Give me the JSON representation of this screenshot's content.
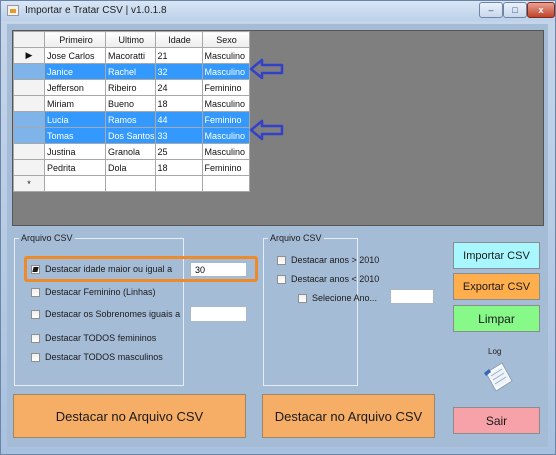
{
  "window": {
    "title": "Importar e Tratar CSV  | v1.0.1.8",
    "min_glyph": "–",
    "max_glyph": "□",
    "close_glyph": "x"
  },
  "grid": {
    "columns": [
      "Primeiro",
      "Ultimo",
      "Idade",
      "Sexo"
    ],
    "rows": [
      {
        "indicator": "▶",
        "primeiro": "Jose Carlos",
        "ultimo": "Macoratti",
        "idade": "21",
        "sexo": "Masculino",
        "selected": false
      },
      {
        "indicator": "",
        "primeiro": "Janice",
        "ultimo": "Rachel",
        "idade": "32",
        "sexo": "Masculino",
        "selected": true
      },
      {
        "indicator": "",
        "primeiro": "Jefferson",
        "ultimo": "Ribeiro",
        "idade": "24",
        "sexo": "Feminino",
        "selected": false
      },
      {
        "indicator": "",
        "primeiro": "Miriam",
        "ultimo": "Bueno",
        "idade": "18",
        "sexo": "Masculino",
        "selected": false
      },
      {
        "indicator": "",
        "primeiro": "Lucia",
        "ultimo": "Ramos",
        "idade": "44",
        "sexo": "Feminino",
        "selected": true
      },
      {
        "indicator": "",
        "primeiro": "Tomas",
        "ultimo": "Dos Santos",
        "idade": "33",
        "sexo": "Masculino",
        "selected": true
      },
      {
        "indicator": "",
        "primeiro": "Justina",
        "ultimo": "Granola",
        "idade": "25",
        "sexo": "Masculino",
        "selected": false
      },
      {
        "indicator": "",
        "primeiro": "Pedrita",
        "ultimo": "Dola",
        "idade": "18",
        "sexo": "Feminino",
        "selected": false
      }
    ],
    "new_row_indicator": "*"
  },
  "group_left": {
    "legend": "Arquivo  CSV",
    "options": [
      {
        "label": "Destacar idade maior ou igual a",
        "checked": true
      },
      {
        "label": "Destacar Feminino (Linhas)",
        "checked": false
      },
      {
        "label": "Destacar os Sobrenomes iguais a",
        "checked": false
      },
      {
        "label": "Destacar TODOS femininos",
        "checked": false
      },
      {
        "label": "Destacar TODOS masculinos",
        "checked": false
      }
    ],
    "idade_value": "30",
    "sobrenome_value": ""
  },
  "group_right": {
    "legend": "Arquivo CSV",
    "options": [
      {
        "label": "Destacar anos > 2010",
        "checked": false
      },
      {
        "label": "Destacar anos < 2010",
        "checked": false
      },
      {
        "label": "Selecione Ano...",
        "checked": false
      }
    ],
    "ano_value": ""
  },
  "buttons": {
    "importar": "Importar CSV",
    "exportar": "Exportar CSV",
    "limpar": "Limpar",
    "sair": "Sair",
    "destacar_left": "Destacar no Arquivo CSV",
    "destacar_right": "Destacar no Arquivo CSV"
  },
  "log": {
    "label": "Log",
    "icon": "log-document-icon"
  },
  "colors": {
    "selection": "#3399ff",
    "highlight_box": "#ef8a2b",
    "arrow": "#3340c8"
  }
}
